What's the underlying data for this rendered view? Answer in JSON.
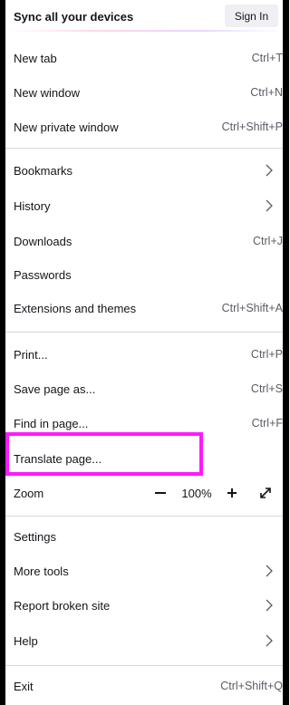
{
  "sync": {
    "label": "Sync all your devices",
    "sign_in": "Sign In"
  },
  "items": {
    "new_tab": {
      "label": "New tab",
      "shortcut": "Ctrl+T"
    },
    "new_window": {
      "label": "New window",
      "shortcut": "Ctrl+N"
    },
    "new_private_window": {
      "label": "New private window",
      "shortcut": "Ctrl+Shift+P"
    },
    "bookmarks": {
      "label": "Bookmarks"
    },
    "history": {
      "label": "History"
    },
    "downloads": {
      "label": "Downloads",
      "shortcut": "Ctrl+J"
    },
    "passwords": {
      "label": "Passwords"
    },
    "extensions": {
      "label": "Extensions and themes",
      "shortcut": "Ctrl+Shift+A"
    },
    "print": {
      "label": "Print...",
      "shortcut": "Ctrl+P"
    },
    "save_page": {
      "label": "Save page as...",
      "shortcut": "Ctrl+S"
    },
    "find_in_page": {
      "label": "Find in page...",
      "shortcut": "Ctrl+F"
    },
    "translate_page": {
      "label": "Translate page..."
    },
    "zoom": {
      "label": "Zoom",
      "minus": "−",
      "value": "100%",
      "plus": "+"
    },
    "settings": {
      "label": "Settings"
    },
    "more_tools": {
      "label": "More tools"
    },
    "report_broken_site": {
      "label": "Report broken site"
    },
    "help": {
      "label": "Help"
    },
    "exit": {
      "label": "Exit",
      "shortcut": "Ctrl+Shift+Q"
    }
  },
  "colors": {
    "highlight": "#ff1aff",
    "shortcut_text": "#5b5b66",
    "separator": "#d7d7db"
  }
}
